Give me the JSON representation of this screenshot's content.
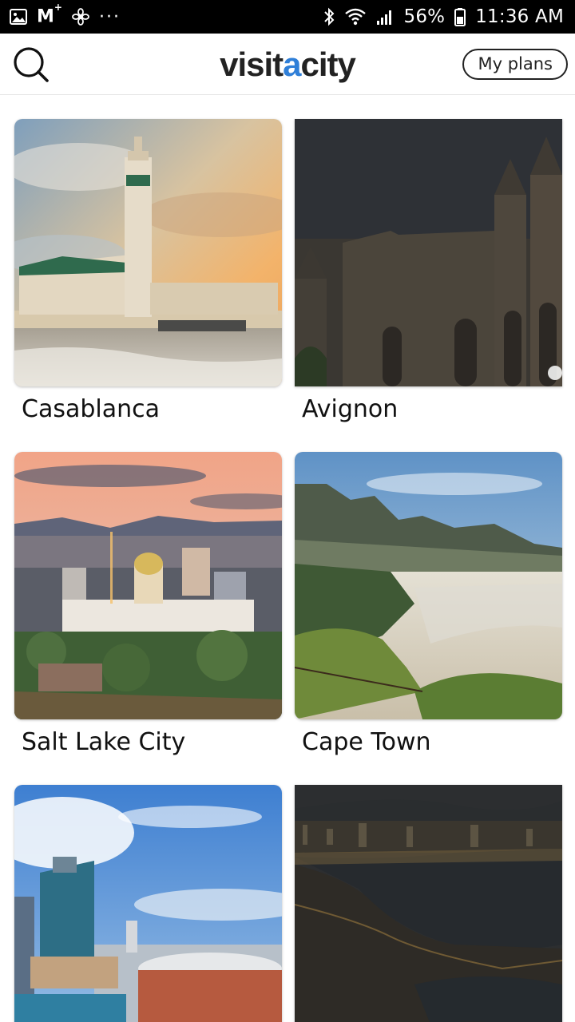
{
  "status_bar": {
    "battery": "56%",
    "time": "11:36 AM",
    "mail_icon_letter": "M",
    "more_dots": "···",
    "icons": [
      "gallery-icon",
      "gmail-icon",
      "fan-icon",
      "more-dots-icon",
      "bluetooth-icon",
      "wifi-icon",
      "signal-icon",
      "battery-icon"
    ]
  },
  "header": {
    "logo_part1": "visit",
    "logo_accent": "a",
    "logo_part2": "city",
    "my_plans_label": "My plans",
    "search_icon": "search-icon",
    "logo_accent_color": "#2f7fd8"
  },
  "cities": [
    {
      "name": "Casablanca"
    },
    {
      "name": "Avignon"
    },
    {
      "name": "Salt Lake City"
    },
    {
      "name": "Cape Town"
    },
    {
      "name": ""
    },
    {
      "name": ""
    }
  ]
}
